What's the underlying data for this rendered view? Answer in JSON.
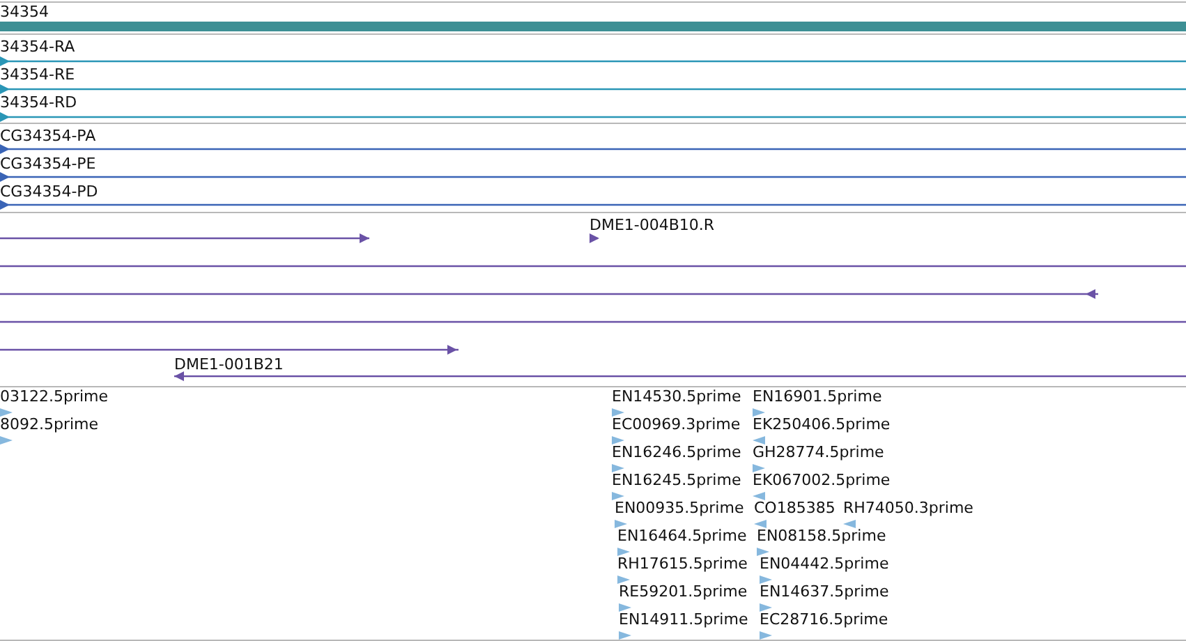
{
  "tracks": [
    {
      "kind": "gene",
      "features": [
        {
          "label": "34354"
        }
      ]
    },
    {
      "kind": "transcript",
      "features": [
        {
          "label": "34354-RA",
          "reverse": false
        },
        {
          "label": "34354-RE",
          "reverse": false
        },
        {
          "label": "34354-RD",
          "reverse": false
        }
      ]
    },
    {
      "kind": "protein",
      "features": [
        {
          "label": "CG34354-PA",
          "reverse": false
        },
        {
          "label": "CG34354-PE",
          "reverse": false
        },
        {
          "label": "CG34354-PD",
          "reverse": false
        }
      ]
    },
    {
      "kind": "clone",
      "features": [
        {
          "kind": "arrow",
          "reverse": false
        },
        {
          "kind": "arrow",
          "label": "DME1-004B10.R",
          "reverse": false
        },
        {
          "kind": "line"
        },
        {
          "kind": "arrow",
          "reverse": true
        },
        {
          "kind": "line"
        },
        {
          "kind": "arrow",
          "reverse": false
        },
        {
          "kind": "arrow",
          "label": "DME1-001B21",
          "reverse": true
        }
      ]
    },
    {
      "kind": "est",
      "features": [
        {
          "label": "03122.5prime",
          "reverse": false
        },
        {
          "label": "EN14530.5prime",
          "reverse": false
        },
        {
          "label": "EN16901.5prime",
          "reverse": false
        },
        {
          "label": "8092.5prime",
          "reverse": false
        },
        {
          "label": "EC00969.3prime",
          "reverse": false
        },
        {
          "label": "EK250406.5prime",
          "reverse": true
        },
        {
          "label": "EN16246.5prime",
          "reverse": false
        },
        {
          "label": "GH28774.5prime",
          "reverse": false
        },
        {
          "label": "EN16245.5prime",
          "reverse": false
        },
        {
          "label": "EK067002.5prime",
          "reverse": true
        },
        {
          "label": "EN00935.5prime",
          "reverse": false
        },
        {
          "label": "CO185385",
          "reverse": true
        },
        {
          "label": "RH74050.3prime",
          "reverse": true
        },
        {
          "label": "EN16464.5prime",
          "reverse": false
        },
        {
          "label": "EN08158.5prime",
          "reverse": false
        },
        {
          "label": "RH17615.5prime",
          "reverse": false
        },
        {
          "label": "EN04442.5prime",
          "reverse": false
        },
        {
          "label": "RE59201.5prime",
          "reverse": false
        },
        {
          "label": "EN14637.5prime",
          "reverse": false
        },
        {
          "label": "EN14911.5prime",
          "reverse": false
        },
        {
          "label": "EC28716.5prime",
          "reverse": false
        }
      ]
    }
  ]
}
